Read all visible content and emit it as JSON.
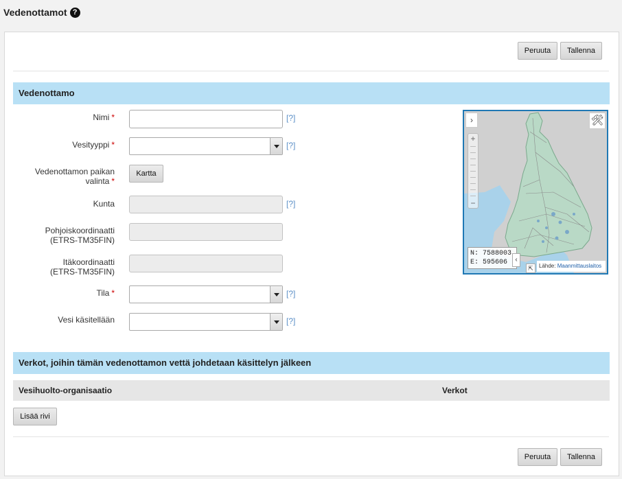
{
  "page": {
    "title": "Vedenottamot",
    "help_glyph": "?"
  },
  "toolbar": {
    "cancel_label": "Peruuta",
    "save_label": "Tallenna"
  },
  "section_main": {
    "title": "Vedenottamo"
  },
  "form": {
    "required_mark": "*",
    "help_text": "[?]",
    "fields": {
      "name": {
        "label": "Nimi",
        "value": ""
      },
      "water_type": {
        "label": "Vesityyppi",
        "value": ""
      },
      "location": {
        "label_line1": "Vedenottamon paikan",
        "label_line2": "valinta",
        "button_label": "Kartta"
      },
      "municipality": {
        "label": "Kunta",
        "value": ""
      },
      "north": {
        "label_line1": "Pohjoiskoordinaatti",
        "label_line2": "(ETRS-TM35FIN)",
        "value": ""
      },
      "east": {
        "label_line1": "Itäkoordinaatti",
        "label_line2": "(ETRS-TM35FIN)",
        "value": ""
      },
      "status": {
        "label": "Tila",
        "value": ""
      },
      "treatment": {
        "label": "Vesi käsitellään",
        "value": ""
      }
    }
  },
  "map": {
    "expand_glyph": "›",
    "tools_glyph": "🛠",
    "zoom_in": "+",
    "zoom_out": "−",
    "coords_n": "N: 7588003",
    "coords_e": "E: 595606",
    "coords_toggle_glyph": "‹",
    "corner_glyph": "⇱",
    "attribution_prefix": "Lähde:",
    "attribution_link": "Maanmittauslaitos",
    "colors": {
      "land": "#b9d9c6",
      "sea": "#a9d2ea",
      "neighbour": "#cdcdcd",
      "roads": "#8a8a8a"
    }
  },
  "section_networks": {
    "title": "Verkot, joihin tämän vedenottamon vettä johdetaan käsittelyn jälkeen",
    "columns": [
      "Vesihuolto-organisaatio",
      "Verkot"
    ],
    "add_row_label": "Lisää rivi"
  }
}
